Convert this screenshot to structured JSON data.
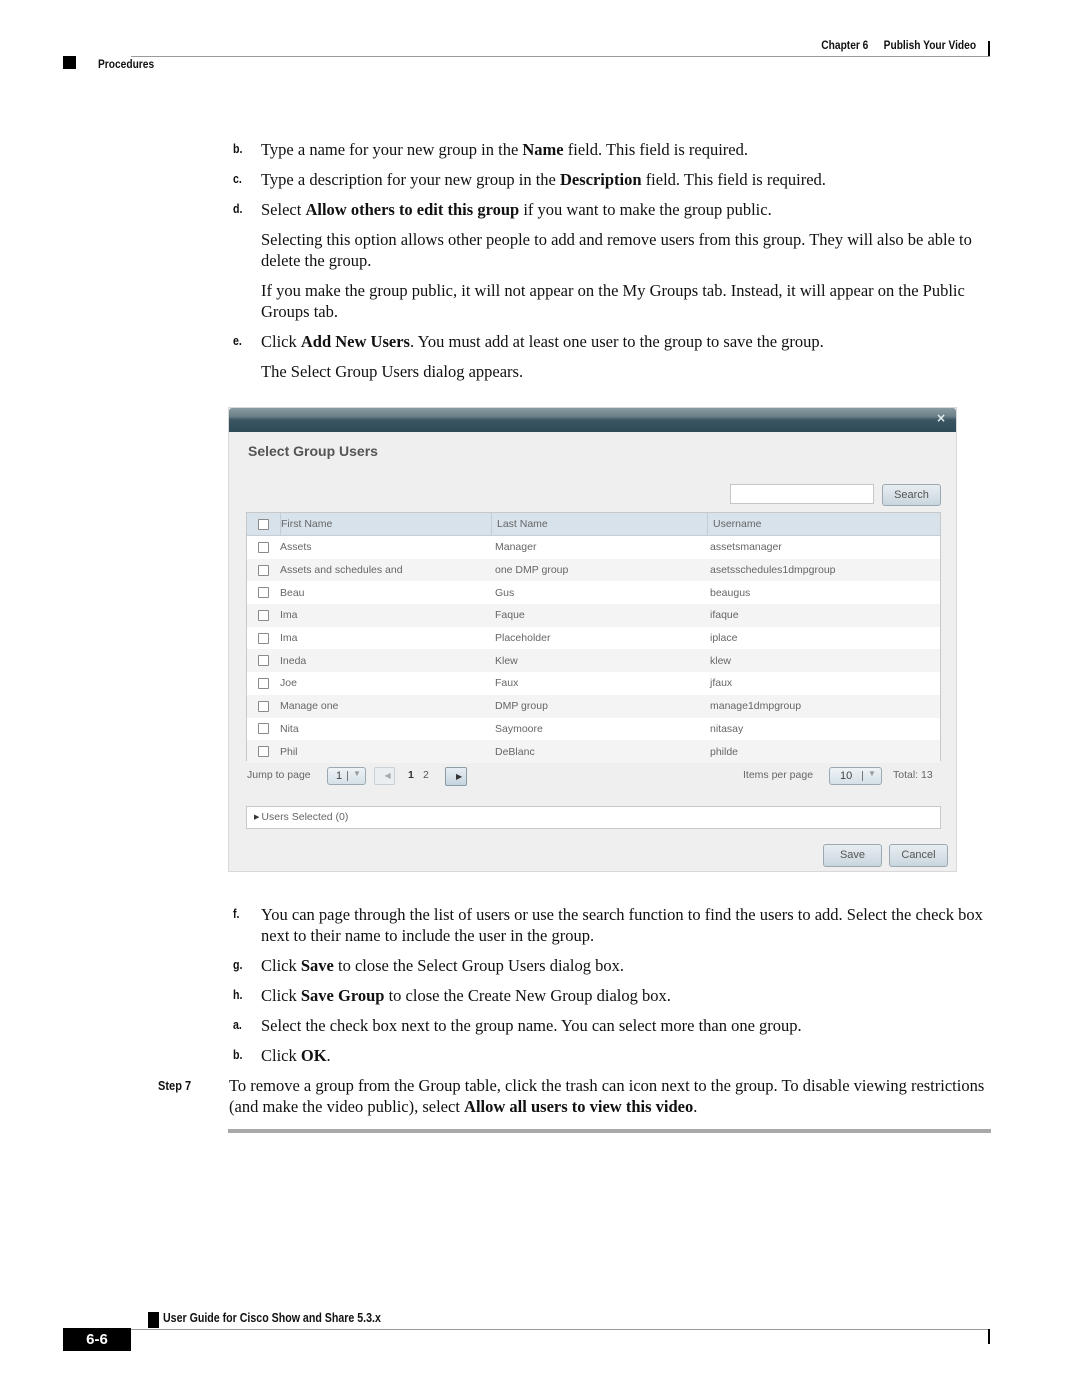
{
  "header": {
    "chapter": "Chapter 6",
    "chapter_title": "Publish Your Video",
    "section": "Procedures"
  },
  "steps_top": [
    {
      "label": "b.",
      "pre": "Type a name for your new group in the ",
      "bold": "Name",
      "post": " field. This field is required."
    },
    {
      "label": "c.",
      "pre": "Type a description for your new group in the ",
      "bold": "Description",
      "post": " field. This field is required."
    },
    {
      "label": "d.",
      "pre": "Select ",
      "bold": "Allow others to edit this group",
      "post": " if you want to make the group public."
    }
  ],
  "notes": [
    "Selecting this option allows other people to add and remove users from this group. They will also be able to delete the group.",
    "If you make the group public, it will not appear on the My Groups tab. Instead, it will appear on the Public Groups tab."
  ],
  "step_e": {
    "label": "e.",
    "pre": "Click ",
    "bold": "Add New Users",
    "post": ". You must add at least one user to the group to save the group."
  },
  "dialog_intro": "The Select Group Users dialog appears.",
  "dialog": {
    "close_glyph": "×",
    "title": "Select Group Users",
    "search_value": "",
    "search_button": "Search",
    "columns": [
      "First Name",
      "Last Name",
      "Username"
    ],
    "rows": [
      {
        "first": "Assets",
        "last": "Manager",
        "username": "assetsmanager",
        "checked": false
      },
      {
        "first": "Assets and schedules and",
        "last": "one DMP group",
        "username": "asetsschedules1dmpgroup",
        "checked": false
      },
      {
        "first": "Beau",
        "last": "Gus",
        "username": "beaugus",
        "checked": false
      },
      {
        "first": "Ima",
        "last": "Faque",
        "username": "ifaque",
        "checked": false
      },
      {
        "first": "Ima",
        "last": "Placeholder",
        "username": "iplace",
        "checked": false
      },
      {
        "first": "Ineda",
        "last": "Klew",
        "username": "klew",
        "checked": false
      },
      {
        "first": "Joe",
        "last": "Faux",
        "username": "jfaux",
        "checked": false
      },
      {
        "first": "Manage one",
        "last": "DMP group",
        "username": "manage1dmpgroup",
        "checked": false
      },
      {
        "first": "Nita",
        "last": "Saymoore",
        "username": "nitasay",
        "checked": false
      },
      {
        "first": "Phil",
        "last": "DeBlanc",
        "username": "philde",
        "checked": false
      }
    ],
    "pager": {
      "jump_label": "Jump to page",
      "jump_value": "1",
      "prev_glyph": "◀",
      "pages": [
        "1",
        "2"
      ],
      "current_page": "1",
      "next_glyph": "▶",
      "items_per_page_label": "Items per page",
      "items_per_page_value": "10",
      "total_text": "Total: 13"
    },
    "users_selected": "Users Selected (0)",
    "save_button": "Save",
    "cancel_button": "Cancel"
  },
  "steps_bottom": [
    {
      "label": "f.",
      "pre": "You can page through the list of users or use the search function to find the users to add. Select the check box next to their name to include the user in the group.",
      "bold": "",
      "post": ""
    },
    {
      "label": "g.",
      "pre": "Click ",
      "bold": "Save",
      "post": " to close the Select Group Users dialog box."
    },
    {
      "label": "h.",
      "pre": "Click ",
      "bold": "Save Group",
      "post": " to close the Create New Group dialog box."
    },
    {
      "label": "a.",
      "pre": "Select the check box next to the group name. You can select more than one group.",
      "bold": "",
      "post": ""
    },
    {
      "label": "b.",
      "pre": "Click ",
      "bold": "OK",
      "post": "."
    }
  ],
  "step7": {
    "label": "Step 7",
    "pre": "To remove a group from the Group table, click the trash can icon next to the group. To disable viewing restrictions (and make the video public), select ",
    "bold": "Allow all users to view this video",
    "post": "."
  },
  "footer": {
    "guide_title": "User Guide for Cisco Show and Share 5.3.x",
    "page_number": "6-6"
  }
}
